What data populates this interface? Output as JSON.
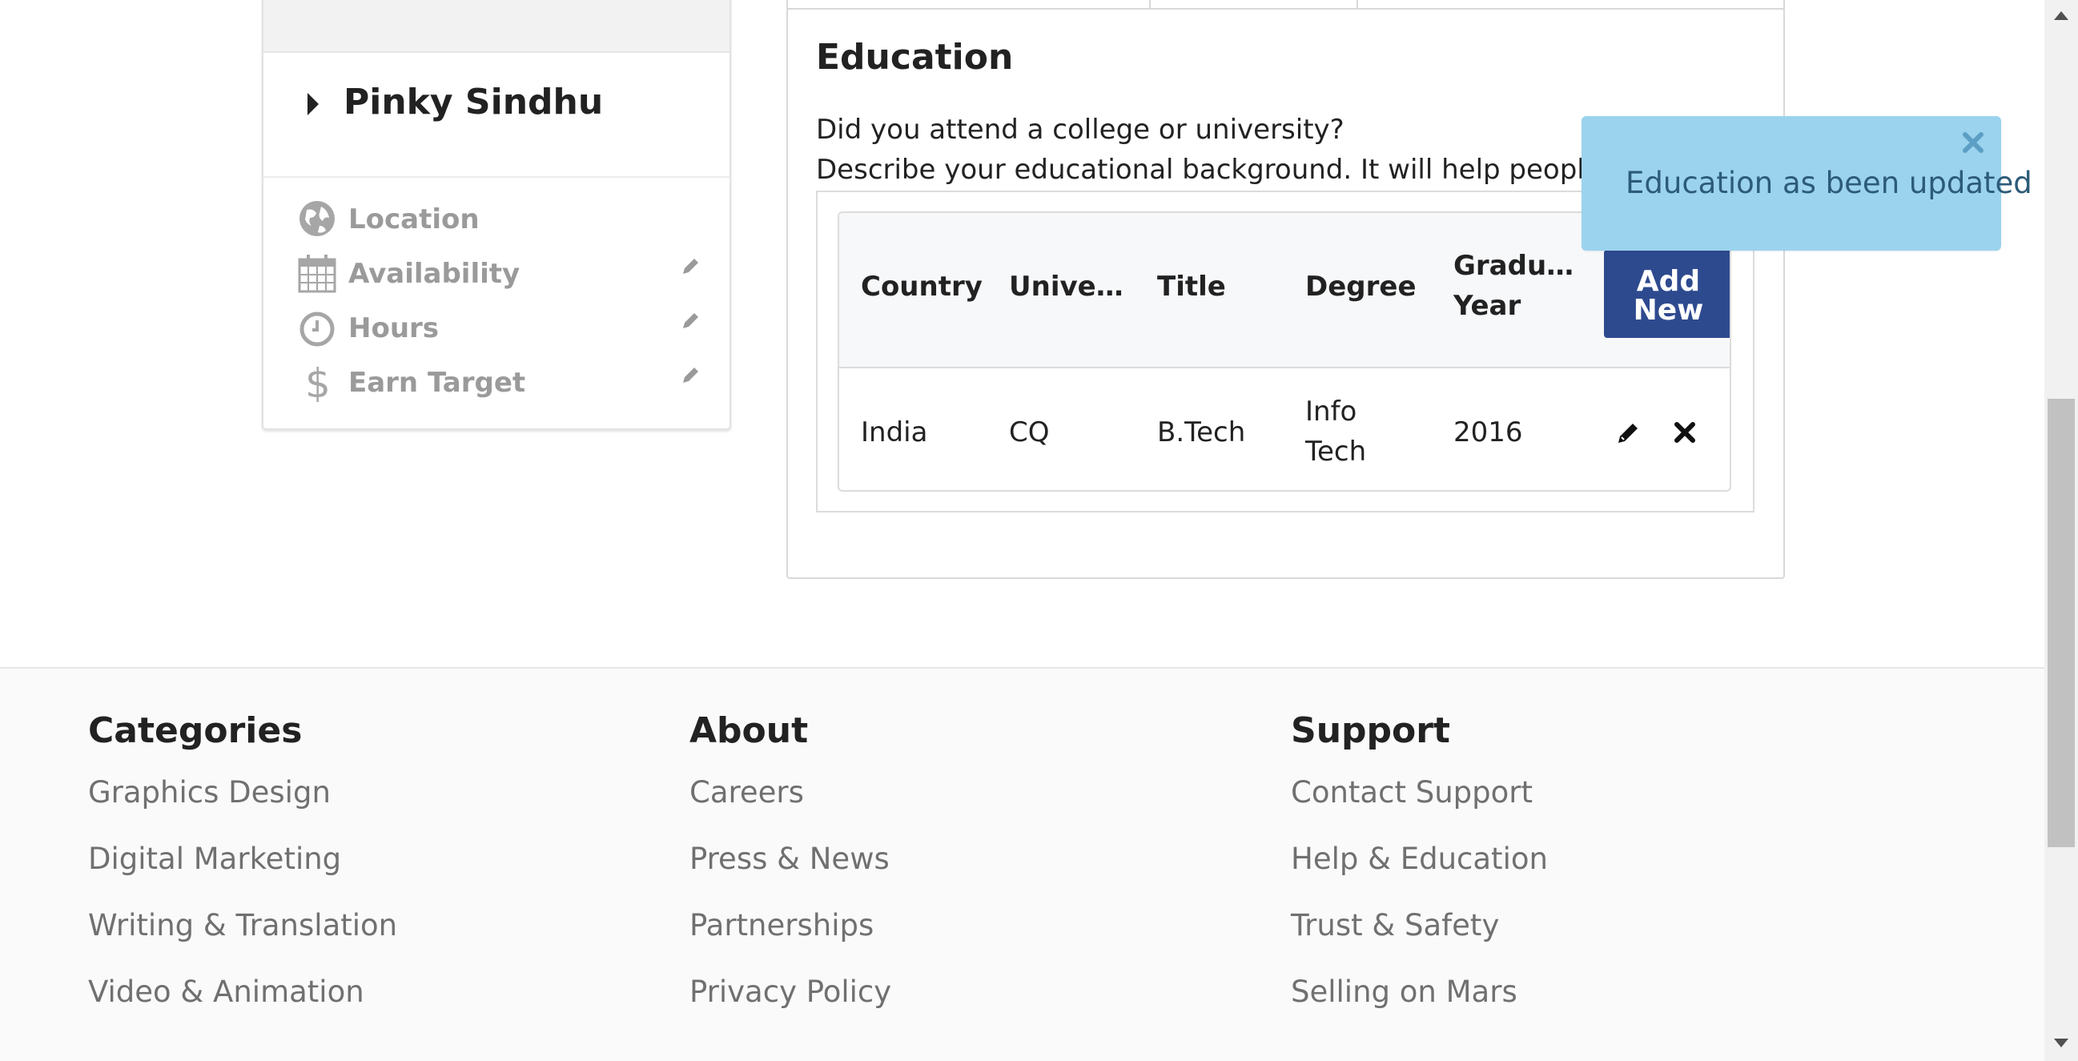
{
  "profile": {
    "name": "Pinky Sindhu",
    "items": [
      {
        "label": "Location",
        "icon": "globe-icon",
        "editable": false
      },
      {
        "label": "Availability",
        "icon": "calendar-icon",
        "editable": true
      },
      {
        "label": "Hours",
        "icon": "clock-icon",
        "editable": true
      },
      {
        "label": "Earn Target",
        "icon": "dollar-icon",
        "editable": true
      }
    ]
  },
  "education": {
    "title": "Education",
    "question": "Did you attend a college or university?",
    "description": "Describe your educational background. It will help people get to know you",
    "add_button": {
      "line1": "Add",
      "line2": "New"
    },
    "columns": [
      "Country",
      "Unive…",
      "Title",
      "Degree",
      "Gradu…",
      "Year"
    ],
    "rows": [
      {
        "country": "India",
        "university": "CQ",
        "title": "B.Tech",
        "degree_line1": "Info",
        "degree_line2": "Tech",
        "year": "2016"
      }
    ]
  },
  "toast": {
    "message": "Education as been updated",
    "color": "#9bd3ee"
  },
  "footer": {
    "categories": {
      "heading": "Categories",
      "links": [
        "Graphics Design",
        "Digital Marketing",
        "Writing & Translation",
        "Video & Animation"
      ]
    },
    "about": {
      "heading": "About",
      "links": [
        "Careers",
        "Press & News",
        "Partnerships",
        "Privacy Policy"
      ]
    },
    "support": {
      "heading": "Support",
      "links": [
        "Contact Support",
        "Help & Education",
        "Trust & Safety",
        "Selling on Mars"
      ]
    }
  },
  "colors": {
    "accent": "#2e4a8f",
    "muted_text": "#9a9a9a",
    "footer_link": "#707070"
  }
}
